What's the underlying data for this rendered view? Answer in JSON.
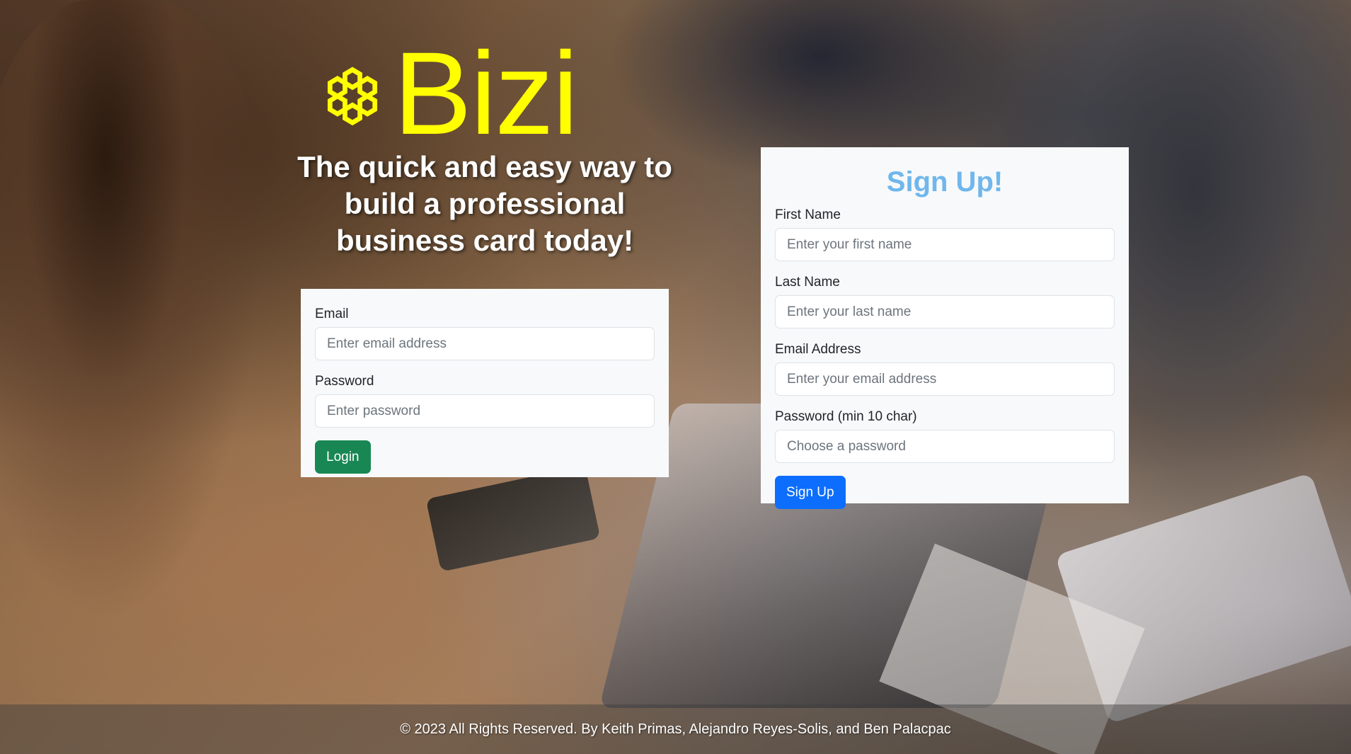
{
  "brand": {
    "name": "Bizi",
    "color": "#ffff00",
    "icon": "honeycomb-icon"
  },
  "tagline": "The quick and easy way to build a professional business card today!",
  "login": {
    "email_label": "Email",
    "email_placeholder": "Enter email address",
    "password_label": "Password",
    "password_placeholder": "Enter password",
    "button_label": "Login",
    "button_color": "#198754"
  },
  "signup": {
    "title": "Sign Up!",
    "title_color": "#6fb7ec",
    "first_name_label": "First Name",
    "first_name_placeholder": "Enter your first name",
    "last_name_label": "Last Name",
    "last_name_placeholder": "Enter your last name",
    "email_label": "Email Address",
    "email_placeholder": "Enter your email address",
    "password_label": "Password (min 10 char)",
    "password_placeholder": "Choose a password",
    "button_label": "Sign Up",
    "button_color": "#0d6efd"
  },
  "footer": {
    "text": "© 2023 All Rights Reserved. By Keith Primas, Alejandro Reyes-Solis, and Ben Palacpac"
  }
}
